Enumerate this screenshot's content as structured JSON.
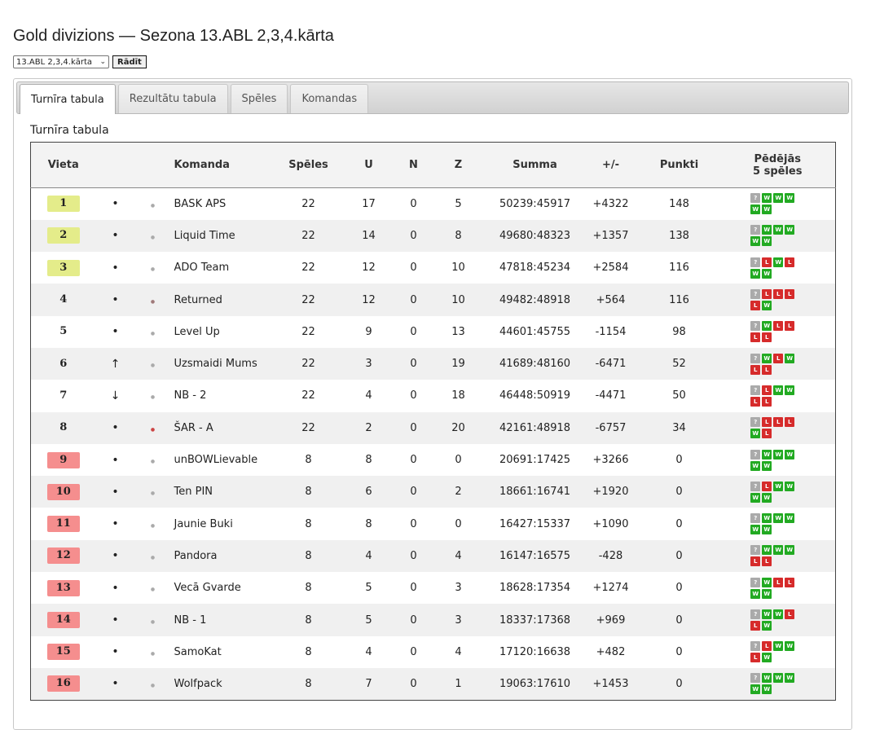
{
  "title": "Gold divizions — Sezona 13.ABL 2,3,4.kārta",
  "controls": {
    "select_value": "13.ABL 2,3,4.kārta",
    "button_label": "Rādīt"
  },
  "tabs": [
    {
      "label": "Turnīra tabula",
      "active": true
    },
    {
      "label": "Rezultātu tabula",
      "active": false
    },
    {
      "label": "Spēles",
      "active": false
    },
    {
      "label": "Komandas",
      "active": false
    }
  ],
  "section_title": "Turnīra tabula",
  "table": {
    "headers": {
      "place": "Vieta",
      "team": "Komanda",
      "games": "Spēles",
      "u": "U",
      "n": "N",
      "z": "Z",
      "sum": "Summa",
      "diff": "+/-",
      "points": "Punkti",
      "last5_line1": "Pēdējās",
      "last5_line2": "5 spēles"
    },
    "colors": {
      "gold": "#e4ec8a",
      "red": "#f58e8e",
      "win": "#22aa22",
      "loss": "#d62b2b",
      "unknown": "#aaaaaa"
    },
    "rows": [
      {
        "place": "1",
        "zone": "gold",
        "trend": "•",
        "team": "BASK APS",
        "games": "22",
        "u": "17",
        "n": "0",
        "z": "5",
        "sum": "50239:45917",
        "diff": "+4322",
        "points": "148",
        "form": [
          "?",
          "W",
          "W",
          "W",
          "W",
          "W"
        ]
      },
      {
        "place": "2",
        "zone": "gold",
        "trend": "•",
        "team": "Liquid Time",
        "games": "22",
        "u": "14",
        "n": "0",
        "z": "8",
        "sum": "49680:48323",
        "diff": "+1357",
        "points": "138",
        "form": [
          "?",
          "W",
          "W",
          "W",
          "W",
          "W"
        ]
      },
      {
        "place": "3",
        "zone": "gold",
        "trend": "•",
        "team": "ADO Team",
        "games": "22",
        "u": "12",
        "n": "0",
        "z": "10",
        "sum": "47818:45234",
        "diff": "+2584",
        "points": "116",
        "form": [
          "?",
          "L",
          "W",
          "L",
          "W",
          "W"
        ]
      },
      {
        "place": "4",
        "zone": "none",
        "trend": "•",
        "team": "Returned",
        "games": "22",
        "u": "12",
        "n": "0",
        "z": "10",
        "sum": "49482:48918",
        "diff": "+564",
        "points": "116",
        "form": [
          "?",
          "L",
          "L",
          "L",
          "L",
          "W"
        ]
      },
      {
        "place": "5",
        "zone": "none",
        "trend": "•",
        "team": "Level Up",
        "games": "22",
        "u": "9",
        "n": "0",
        "z": "13",
        "sum": "44601:45755",
        "diff": "-1154",
        "points": "98",
        "form": [
          "?",
          "W",
          "L",
          "L",
          "L",
          "L"
        ]
      },
      {
        "place": "6",
        "zone": "none",
        "trend": "↑",
        "team": "Uzsmaidi Mums",
        "games": "22",
        "u": "3",
        "n": "0",
        "z": "19",
        "sum": "41689:48160",
        "diff": "-6471",
        "points": "52",
        "form": [
          "?",
          "W",
          "L",
          "W",
          "L",
          "L"
        ]
      },
      {
        "place": "7",
        "zone": "none",
        "trend": "↓",
        "team": "NB - 2",
        "games": "22",
        "u": "4",
        "n": "0",
        "z": "18",
        "sum": "46448:50919",
        "diff": "-4471",
        "points": "50",
        "form": [
          "?",
          "L",
          "W",
          "W",
          "L",
          "L"
        ]
      },
      {
        "place": "8",
        "zone": "none",
        "trend": "•",
        "team": "ŠAR - A",
        "games": "22",
        "u": "2",
        "n": "0",
        "z": "20",
        "sum": "42161:48918",
        "diff": "-6757",
        "points": "34",
        "form": [
          "?",
          "L",
          "L",
          "L",
          "W",
          "L"
        ]
      },
      {
        "place": "9",
        "zone": "red",
        "trend": "•",
        "team": "unBOWLievable",
        "games": "8",
        "u": "8",
        "n": "0",
        "z": "0",
        "sum": "20691:17425",
        "diff": "+3266",
        "points": "0",
        "form": [
          "?",
          "W",
          "W",
          "W",
          "W",
          "W"
        ]
      },
      {
        "place": "10",
        "zone": "red",
        "trend": "•",
        "team": "Ten PIN",
        "games": "8",
        "u": "6",
        "n": "0",
        "z": "2",
        "sum": "18661:16741",
        "diff": "+1920",
        "points": "0",
        "form": [
          "?",
          "L",
          "W",
          "W",
          "W",
          "W"
        ]
      },
      {
        "place": "11",
        "zone": "red",
        "trend": "•",
        "team": "Jaunie Buki",
        "games": "8",
        "u": "8",
        "n": "0",
        "z": "0",
        "sum": "16427:15337",
        "diff": "+1090",
        "points": "0",
        "form": [
          "?",
          "W",
          "W",
          "W",
          "W",
          "W"
        ]
      },
      {
        "place": "12",
        "zone": "red",
        "trend": "•",
        "team": "Pandora",
        "games": "8",
        "u": "4",
        "n": "0",
        "z": "4",
        "sum": "16147:16575",
        "diff": "-428",
        "points": "0",
        "form": [
          "?",
          "W",
          "W",
          "W",
          "L",
          "L"
        ]
      },
      {
        "place": "13",
        "zone": "red",
        "trend": "•",
        "team": "Vecā Gvarde",
        "games": "8",
        "u": "5",
        "n": "0",
        "z": "3",
        "sum": "18628:17354",
        "diff": "+1274",
        "points": "0",
        "form": [
          "?",
          "W",
          "L",
          "L",
          "W",
          "W"
        ]
      },
      {
        "place": "14",
        "zone": "red",
        "trend": "•",
        "team": "NB - 1",
        "games": "8",
        "u": "5",
        "n": "0",
        "z": "3",
        "sum": "18337:17368",
        "diff": "+969",
        "points": "0",
        "form": [
          "?",
          "W",
          "W",
          "L",
          "L",
          "W"
        ]
      },
      {
        "place": "15",
        "zone": "red",
        "trend": "•",
        "team": "SamoKat",
        "games": "8",
        "u": "4",
        "n": "0",
        "z": "4",
        "sum": "17120:16638",
        "diff": "+482",
        "points": "0",
        "form": [
          "?",
          "L",
          "W",
          "W",
          "L",
          "W"
        ]
      },
      {
        "place": "16",
        "zone": "red",
        "trend": "•",
        "team": "Wolfpack",
        "games": "8",
        "u": "7",
        "n": "0",
        "z": "1",
        "sum": "19063:17610",
        "diff": "+1453",
        "points": "0",
        "form": [
          "?",
          "W",
          "W",
          "W",
          "W",
          "W"
        ]
      }
    ]
  }
}
